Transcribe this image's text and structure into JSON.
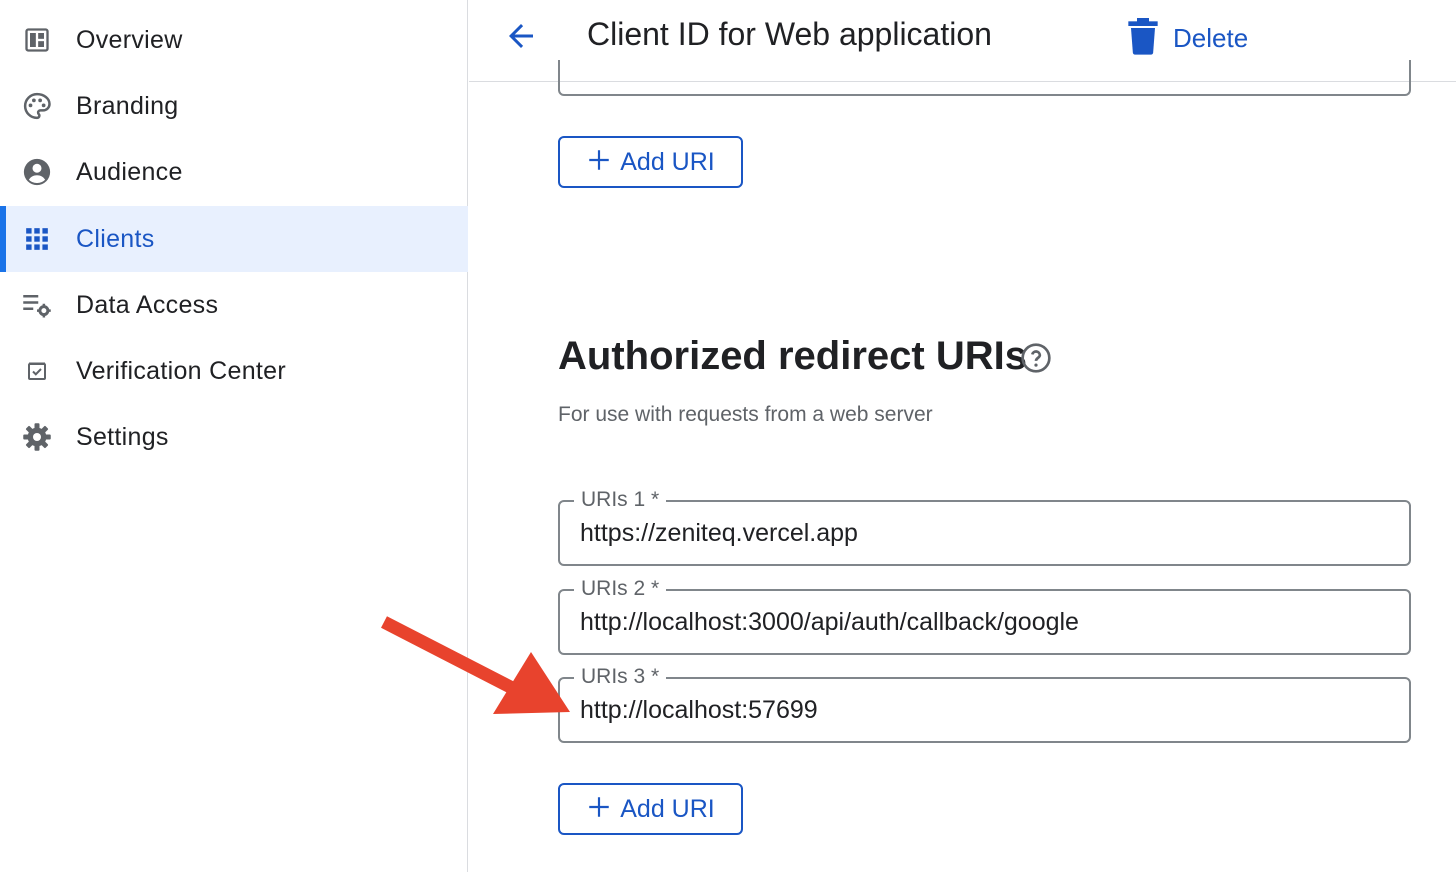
{
  "sidebar": {
    "items": [
      {
        "label": "Overview",
        "icon": "dashboard-icon",
        "active": false
      },
      {
        "label": "Branding",
        "icon": "palette-icon",
        "active": false
      },
      {
        "label": "Audience",
        "icon": "account-circle-icon",
        "active": false
      },
      {
        "label": "Clients",
        "icon": "apps-grid-icon",
        "active": true
      },
      {
        "label": "Data Access",
        "icon": "list-settings-icon",
        "active": false
      },
      {
        "label": "Verification Center",
        "icon": "checkbox-icon",
        "active": false
      },
      {
        "label": "Settings",
        "icon": "gear-icon",
        "active": false
      }
    ]
  },
  "header": {
    "title": "Client ID for Web application",
    "back_icon": "arrow-back-icon",
    "delete_label": "Delete",
    "delete_icon": "trash-icon"
  },
  "main": {
    "add_uri_label": "Add URI",
    "redirect": {
      "title": "Authorized redirect URIs",
      "subtitle": "For use with requests from a web server",
      "fields": [
        {
          "label": "URIs 1 *",
          "value": "https://zeniteq.vercel.app"
        },
        {
          "label": "URIs 2 *",
          "value": "http://localhost:3000/api/auth/callback/google"
        },
        {
          "label": "URIs 3 *",
          "value": "http://localhost:57699"
        }
      ]
    }
  },
  "annotation": {
    "arrow_color": "#e8432d",
    "points_to": "URIs 3"
  },
  "colors": {
    "accent": "#1a56c4",
    "active_bg": "#e8f0fe",
    "border": "#80868b"
  }
}
